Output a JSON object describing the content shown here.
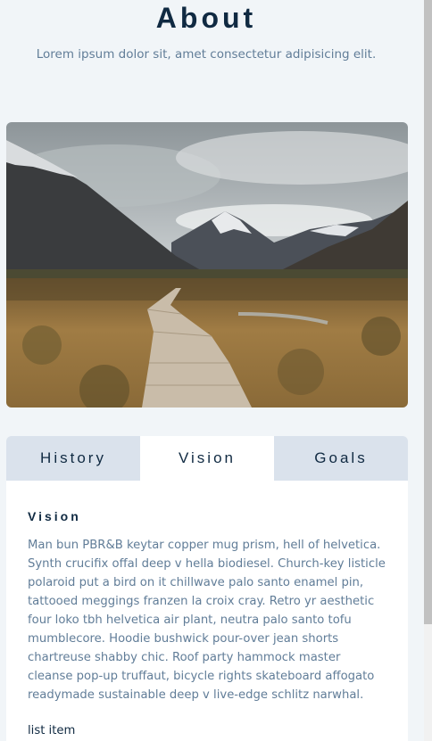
{
  "header": {
    "title": "About",
    "subtitle": "Lorem ipsum dolor sit, amet consectetur adipisicing elit."
  },
  "hero": {
    "alt": "mountain-trail-photo"
  },
  "tabs": [
    {
      "label": "History",
      "active": false
    },
    {
      "label": "Vision",
      "active": true
    },
    {
      "label": "Goals",
      "active": false
    }
  ],
  "panel": {
    "heading": "Vision",
    "body": "Man bun PBR&B keytar copper mug prism, hell of helvetica. Synth crucifix offal deep v hella biodiesel. Church-key listicle polaroid put a bird on it chillwave palo santo enamel pin, tattooed meggings franzen la croix cray. Retro yr aesthetic four loko tbh helvetica air plant, neutra palo santo tofu mumblecore. Hoodie bushwick pour-over jean shorts chartreuse shabby chic. Roof party hammock master cleanse pop-up truffaut, bicycle rights skateboard affogato readymade sustainable deep v live-edge schlitz narwhal.",
    "list_item": "list item"
  },
  "colors": {
    "background": "#f1f5f8",
    "title": "#102a42",
    "muted": "#617d98",
    "tab_inactive": "#dae2ec",
    "tab_active": "#ffffff"
  }
}
